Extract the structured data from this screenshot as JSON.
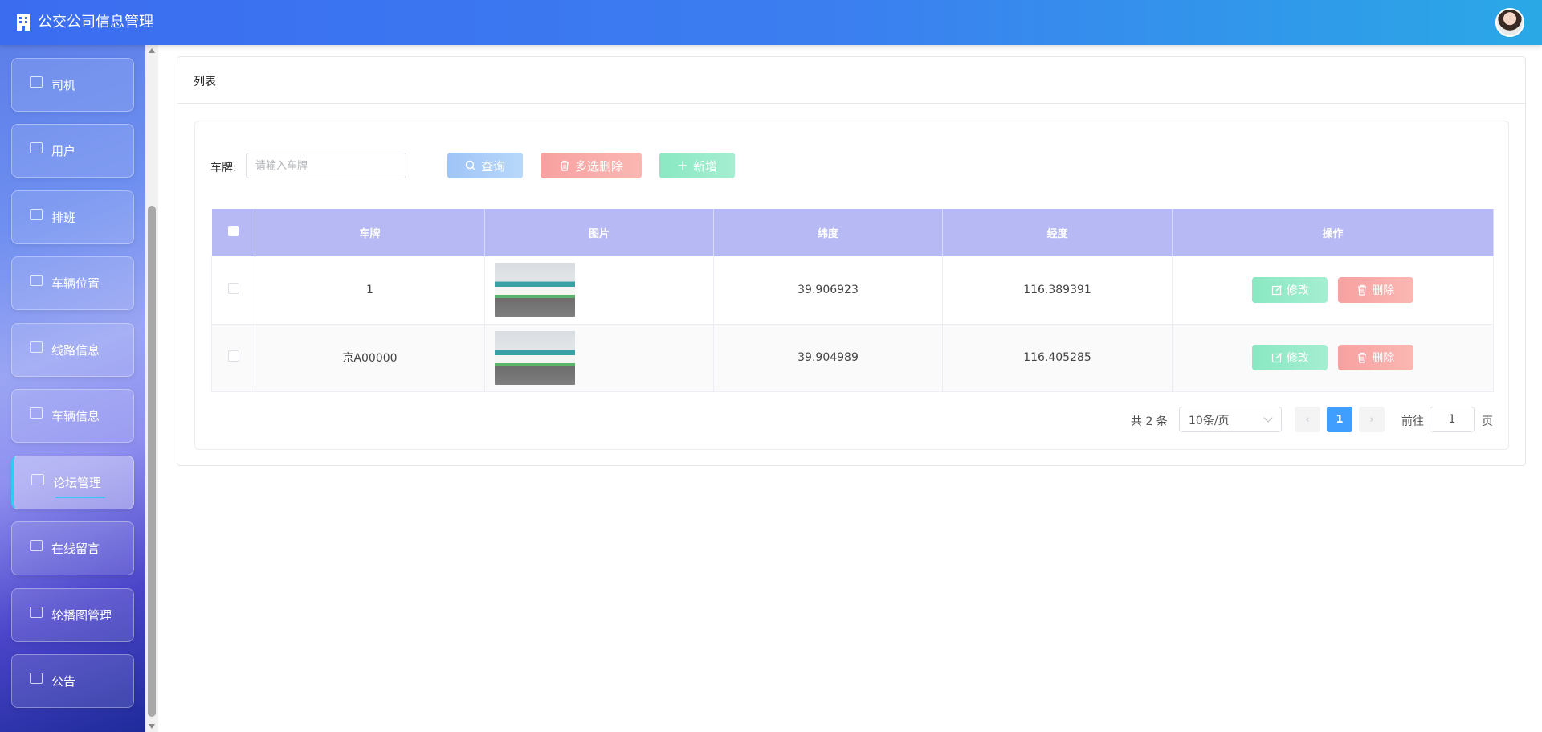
{
  "header": {
    "title": "公交公司信息管理"
  },
  "sidebar": {
    "items": [
      {
        "label": "司机",
        "icon": "calendar-icon"
      },
      {
        "label": "用户",
        "icon": "box-icon"
      },
      {
        "label": "排班",
        "icon": "id-card-icon"
      },
      {
        "label": "车辆位置",
        "icon": "phone-icon"
      },
      {
        "label": "线路信息",
        "icon": "route-icon"
      },
      {
        "label": "车辆信息",
        "icon": "bus-icon"
      },
      {
        "label": "论坛管理",
        "icon": "forum-icon",
        "active": true
      },
      {
        "label": "在线留言",
        "icon": "message-icon"
      },
      {
        "label": "轮播图管理",
        "icon": "monitor-icon"
      },
      {
        "label": "公告",
        "icon": "monitor-icon"
      }
    ]
  },
  "card": {
    "title": "列表"
  },
  "search": {
    "label": "车牌:",
    "placeholder": "请输入车牌"
  },
  "buttons": {
    "query": "查询",
    "multi_delete": "多选删除",
    "add": "新增"
  },
  "table": {
    "headers": [
      "车牌",
      "图片",
      "纬度",
      "经度",
      "操作"
    ],
    "rows": [
      {
        "plate": "1",
        "lat": "39.906923",
        "lng": "116.389391"
      },
      {
        "plate": "京A00000",
        "lat": "39.904989",
        "lng": "116.405285"
      }
    ],
    "actions": {
      "edit": "修改",
      "delete": "删除"
    }
  },
  "pagination": {
    "total": "共 2 条",
    "page_size": "10条/页",
    "current_page": "1",
    "goto_label": "前往",
    "goto_value": "1",
    "goto_unit": "页"
  },
  "colors": {
    "header_start": "#3b6cf0",
    "header_end": "#2aa8e6",
    "table_header": "#b7b9f5",
    "query_button": "#9fc4f7",
    "delete_button": "#f7a1a1",
    "add_button": "#89e8c2",
    "active_page": "#409eff"
  }
}
